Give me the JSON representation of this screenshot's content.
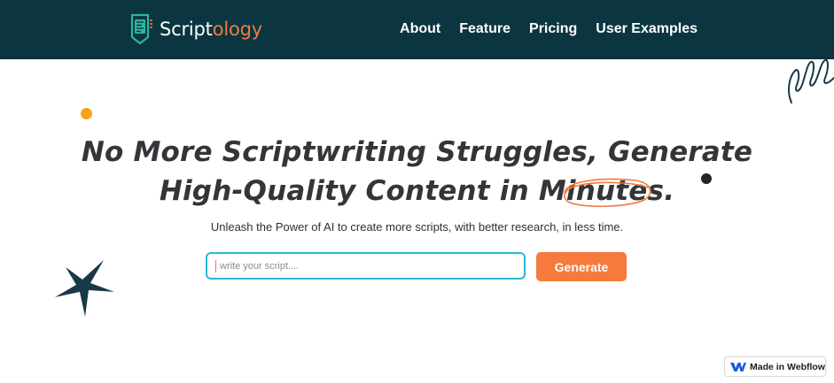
{
  "brand": {
    "name_part_1": "Script",
    "name_part_2": "ology",
    "accent_color": "#f07a3e",
    "nav_bg_color": "#0b3641"
  },
  "nav": {
    "items": [
      {
        "label": "About"
      },
      {
        "label": "Feature"
      },
      {
        "label": "Pricing"
      },
      {
        "label": "User Examples"
      }
    ]
  },
  "hero": {
    "headline_line_1": "No More Scriptwriting Struggles, Generate",
    "headline_line_2_prefix": "High-Quality Content in M",
    "headline_line_2_highlight": "inutes",
    "headline_line_2_suffix": ".",
    "subtitle": "Unleash the Power of AI to create more scripts, with better research, in less time."
  },
  "search": {
    "placeholder": "write your script....",
    "value": "",
    "button_label": "Generate",
    "input_border_color": "#2bb7d6",
    "button_color": "#f57a3c"
  },
  "badge": {
    "label": "Made in Webflow",
    "icon": "webflow-icon"
  },
  "decorations": {
    "icons": [
      "orange-dot-icon",
      "dark-dot-icon",
      "squiggle-icon",
      "star-icon",
      "scribble-circle-icon"
    ],
    "orange_dot_color": "#f5a31a",
    "dark_dot_color": "#222629",
    "star_color": "#173a47"
  }
}
